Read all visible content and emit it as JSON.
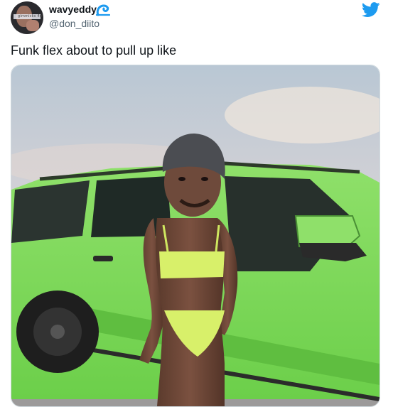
{
  "user": {
    "display_name": "wavyeddy",
    "handle": "@don_diito",
    "avatar_icon": "user-avatar",
    "avatar_band_text": "gimmicks 4u"
  },
  "badge_icon": "wave-emoji-icon",
  "brand_icon": "twitter-bird-icon",
  "colors": {
    "brand": "#1d9bf0",
    "text": "#0f1419",
    "muted": "#536471",
    "car_green": "#7ed957"
  },
  "tweet": {
    "text": "Funk flex about to pull up like"
  },
  "media": {
    "type": "photo",
    "alt_icon": "photo-media"
  }
}
